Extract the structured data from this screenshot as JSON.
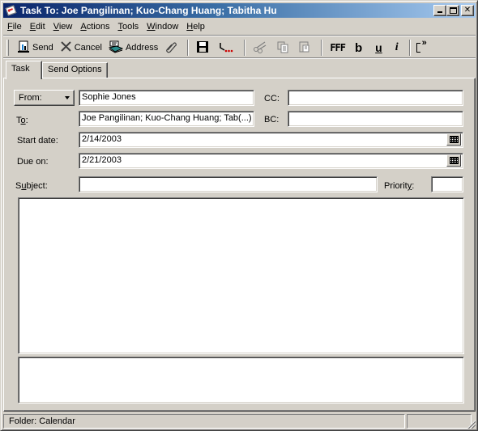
{
  "window": {
    "title": "Task To: Joe Pangilinan; Kuo-Chang Huang; Tabitha Hu",
    "app_icon": "task-icon",
    "controls": {
      "minimize": "minimize",
      "maximize": "maximize",
      "close": "close"
    }
  },
  "menu": [
    {
      "label": "File",
      "accel": "F",
      "rest": "ile"
    },
    {
      "label": "Edit",
      "accel": "E",
      "rest": "dit"
    },
    {
      "label": "View",
      "accel": "V",
      "rest": "iew"
    },
    {
      "label": "Actions",
      "accel": "A",
      "rest": "ctions"
    },
    {
      "label": "Tools",
      "accel": "T",
      "rest": "ools"
    },
    {
      "label": "Window",
      "accel": "W",
      "rest": "indow"
    },
    {
      "label": "Help",
      "accel": "H",
      "rest": "elp"
    }
  ],
  "toolbar": {
    "send": {
      "label": "Send",
      "icon": "send-icon"
    },
    "cancel": {
      "label": "Cancel",
      "icon": "cancel-icon"
    },
    "address": {
      "label": "Address",
      "icon": "address-book-icon"
    },
    "attach": {
      "icon": "paperclip-icon"
    },
    "save": {
      "icon": "save-icon"
    },
    "recurrence": {
      "icon": "recurrence-icon"
    },
    "cut": {
      "icon": "scissors-icon",
      "disabled": true
    },
    "copy": {
      "icon": "copy-icon",
      "disabled": true
    },
    "paste": {
      "icon": "paste-icon",
      "disabled": true
    },
    "font": {
      "glyph": "FFF",
      "icon": "font-icon"
    },
    "bold": {
      "glyph": "b",
      "icon": "bold-icon"
    },
    "underline": {
      "glyph": "u",
      "icon": "underline-icon"
    },
    "italic": {
      "glyph": "i",
      "icon": "italic-icon"
    },
    "more": {
      "glyph": "»",
      "icon": "overflow-chevron-icon"
    }
  },
  "tabs": [
    {
      "label": "Task",
      "active": true
    },
    {
      "label": "Send Options",
      "active": false
    }
  ],
  "form": {
    "from": {
      "label": "From:",
      "value": "Sophie Jones"
    },
    "to": {
      "label_pre": "T",
      "label_accel": "o",
      "label_post": ":",
      "value": "Joe Pangilinan; Kuo-Chang Huang; Tab(...)"
    },
    "cc": {
      "label": "CC:",
      "value": ""
    },
    "bc": {
      "label": "BC:",
      "value": ""
    },
    "start_date": {
      "label": "Start date:",
      "value": "2/14/2003"
    },
    "due_on": {
      "label": "Due on:",
      "value": "2/21/2003"
    },
    "subject": {
      "label_pre": "S",
      "label_accel": "u",
      "label_post": "bject:",
      "value": ""
    },
    "priority": {
      "label_pre": "Priorit",
      "label_accel": "y",
      "label_post": ":",
      "value": ""
    },
    "message_body": "",
    "notes": ""
  },
  "status": {
    "folder": "Folder: Calendar",
    "right_pane": ""
  }
}
